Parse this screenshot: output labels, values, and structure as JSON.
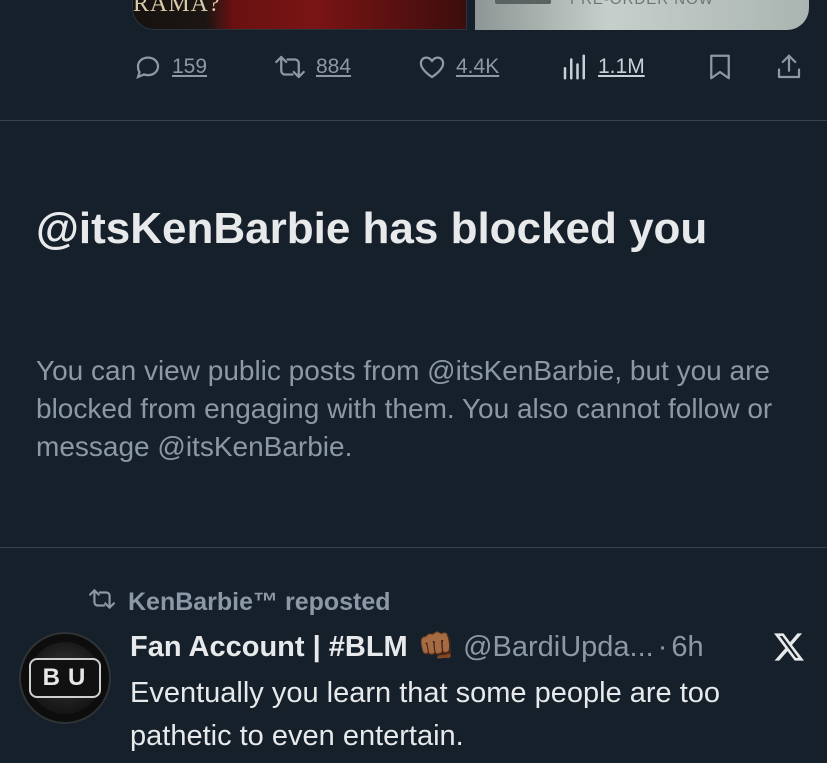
{
  "media": {
    "left_text": "RAMA?",
    "right_text": "PRE-ORDER NOW"
  },
  "actions": {
    "reply_count": "159",
    "repost_count": "884",
    "like_count": "4.4K",
    "views_count": "1.1M"
  },
  "blocked": {
    "title": "@itsKenBarbie has blocked you",
    "description": "You can view public posts from @itsKenBarbie, but you are blocked from engaging with them. You also cannot follow or message @itsKenBarbie."
  },
  "repost": {
    "label": "KenBarbie™ reposted"
  },
  "post": {
    "avatar_text": "BU",
    "display_name": "Fan Account | #BLM",
    "emoji": "👊🏾",
    "handle": "@BardiUpda...",
    "separator": "·",
    "time": "6h",
    "text": "Eventually you learn that some people are too pathetic to even entertain."
  },
  "colors": {
    "background": "#15202b",
    "primary_text": "#e7e9ea",
    "secondary_text": "#8b98a5",
    "divider": "#38444d"
  },
  "icons": [
    "reply-icon",
    "repost-icon",
    "like-icon",
    "views-icon",
    "bookmark-icon",
    "share-icon",
    "x-logo-icon"
  ]
}
